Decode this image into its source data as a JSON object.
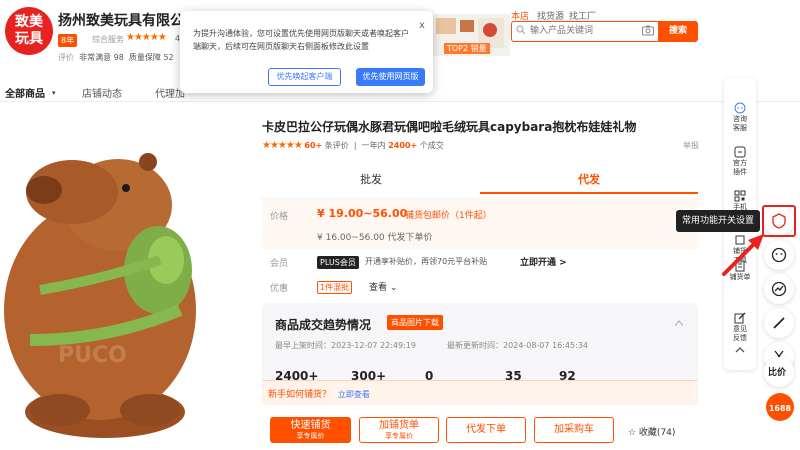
{
  "header": {
    "logo_text": "致美\n玩具",
    "shop_name": "扬州致美玩具有限公司",
    "year_badge": "8年",
    "service_label": "综合服务",
    "stars": "★★★★★",
    "score": "4.",
    "metrics_label_1": "评价",
    "metrics_value_1": "非常满意 98",
    "metrics_label_2": "质量保障 52",
    "top_links": [
      "本店",
      "找货源",
      "找工厂"
    ],
    "search_placeholder": "输入产品关键词",
    "search_button": "搜索",
    "top2_badge": "TOP2 销量"
  },
  "popup": {
    "text": "为提升沟通体验，您可设置优先使用网页版聊天或者唤起客户端聊天，后续可在网页版聊天右侧面板修改此设置",
    "close": "x",
    "btn_client": "优先唤起客户端",
    "btn_web": "优先使用网页版"
  },
  "nav": {
    "items": [
      "全部商品",
      "店铺动态",
      "代理加",
      "...",
      "..."
    ]
  },
  "product": {
    "title": "卡皮巴拉公仔玩偶水豚君玩偶吧啦毛绒玩具capybara抱枕布娃娃礼物",
    "stars": "★★★★★",
    "reviews_count": "60+",
    "reviews_label": "条评价",
    "sales_prefix": "一年内",
    "sales_count": "2400+",
    "sales_suffix": "个成交",
    "report": "举报",
    "tabs": [
      "批发",
      "代发"
    ],
    "price_label": "价格",
    "price_range": "¥ 19.00~56.00",
    "price_note": "铺货包邮价（1件起）",
    "price_sub": "¥ 16.00~56.00  代发下单价",
    "member_label": "会员",
    "plus_badge": "PLUS会员",
    "plus_text": "开通享补贴价，再领70元平台补贴",
    "plus_open": "立即开通 >",
    "discount_label": "优惠",
    "discount_badge": "1件混批",
    "discount_view": "查看 ⌄"
  },
  "trend": {
    "title": "商品成交趋势情况",
    "download": "商品图片下载",
    "first_listed": "最早上架时间：2023-12-07 22:49:19",
    "last_updated": "最新更新时间：2024-08-07 16:45:34",
    "stats": [
      "2400+",
      "300+",
      "0",
      "35",
      "92"
    ]
  },
  "action_bar": {
    "how_to": "新手如何铺货？",
    "how_to_link": "立即查看",
    "quick_list": "快速铺货",
    "quick_list_sub": "享专属价",
    "add_list": "加铺货单",
    "add_list_sub": "享专属价",
    "dropship_order": "代发下单",
    "add_cart": "加采购车",
    "favorite": "☆ 收藏(74)"
  },
  "sidebar": {
    "items": [
      {
        "label": "咨询\n客服",
        "icon": "chat-icon"
      },
      {
        "label": "官方\n插件",
        "icon": "plugin-icon"
      },
      {
        "label": "手机\n下单",
        "icon": "qrcode-icon"
      },
      {
        "label": "铺货\n工具",
        "icon": "tool-icon"
      },
      {
        "label": "铺货单",
        "icon": "list-icon"
      },
      {
        "label": "意见\n反馈",
        "icon": "edit-icon"
      }
    ],
    "tooltip": "常用功能开关设置",
    "price_compare": "比价",
    "logo_1688": "1688"
  },
  "colors": {
    "brand_orange": "#ff5000",
    "highlight_red": "#e8231f",
    "link_blue": "#3a7bfa"
  }
}
